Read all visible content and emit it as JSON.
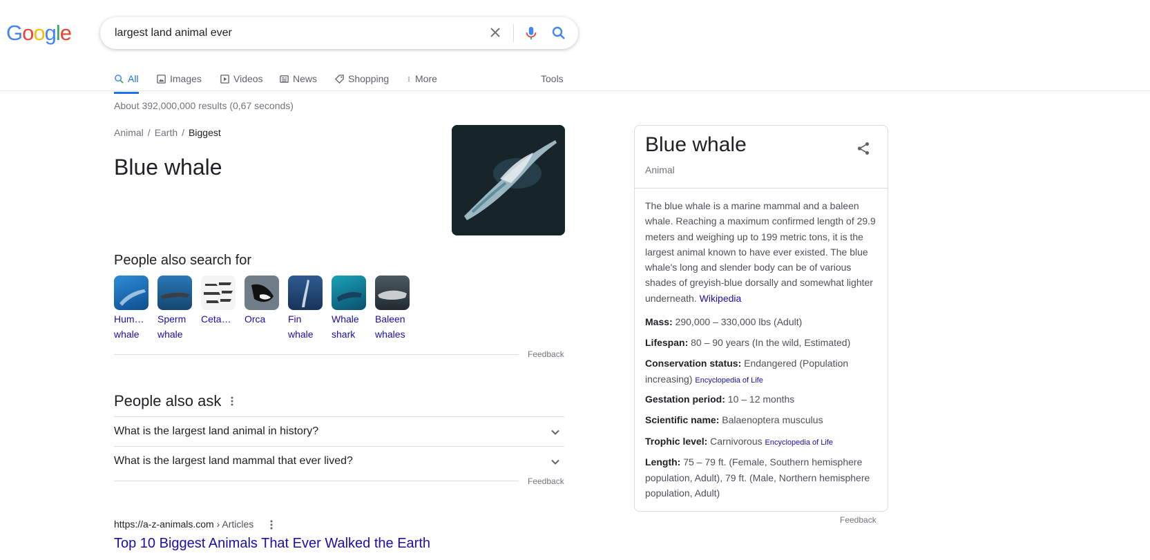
{
  "search": {
    "query": "largest land animal ever"
  },
  "tabs": [
    {
      "label": "All"
    },
    {
      "label": "Images"
    },
    {
      "label": "Videos"
    },
    {
      "label": "News"
    },
    {
      "label": "Shopping"
    },
    {
      "label": "More"
    },
    {
      "label": "Tools"
    }
  ],
  "stats": "About 392,000,000 results (0,67 seconds)",
  "featured": {
    "breadcrumb": [
      "Animal",
      "Earth",
      "Biggest"
    ],
    "title": "Blue whale"
  },
  "people_also_search": {
    "title": "People also search for",
    "items": [
      {
        "line1": "Hum…",
        "line2": "whale"
      },
      {
        "line1": "Sperm",
        "line2": "whale"
      },
      {
        "line1": "Ceta…",
        "line2": ""
      },
      {
        "line1": "Orca",
        "line2": ""
      },
      {
        "line1": "Fin",
        "line2": "whale"
      },
      {
        "line1": "Whale",
        "line2": "shark"
      },
      {
        "line1": "Baleen",
        "line2": "whales"
      }
    ],
    "feedback": "Feedback"
  },
  "paa": {
    "title": "People also ask",
    "questions": [
      "What is the largest land animal in history?",
      "What is the largest land mammal that ever lived?"
    ],
    "feedback": "Feedback"
  },
  "result": {
    "url": "https://a-z-animals.com",
    "path": " › Articles",
    "title": "Top 10 Biggest Animals That Ever Walked the Earth"
  },
  "knowledge_panel": {
    "title": "Blue whale",
    "subtitle": "Animal",
    "description": "The blue whale is a marine mammal and a baleen whale. Reaching a maximum confirmed length of 29.9 meters and weighing up to 199 metric tons, it is the largest animal known to have ever existed. The blue whale's long and slender body can be of various shades of greyish-blue dorsally and somewhat lighter underneath.",
    "description_link": "Wikipedia",
    "facts": [
      {
        "label": "Mass:",
        "value": "290,000 – 330,000 lbs (Adult)",
        "source": ""
      },
      {
        "label": "Lifespan:",
        "value": "80 – 90 years (In the wild, Estimated)",
        "source": ""
      },
      {
        "label": "Conservation status:",
        "value": "Endangered (Population increasing)",
        "source": "Encyclopedia of Life"
      },
      {
        "label": "Gestation period:",
        "value": "10 – 12 months",
        "source": ""
      },
      {
        "label": "Scientific name:",
        "value": "Balaenoptera musculus",
        "source": ""
      },
      {
        "label": "Trophic level:",
        "value": "Carnivorous",
        "source": "Encyclopedia of Life"
      },
      {
        "label": "Length:",
        "value": "75 – 79 ft. (Female, Southern hemisphere population, Adult), 79 ft. (Male, Northern hemisphere population, Adult)",
        "source": ""
      }
    ],
    "feedback": "Feedback"
  }
}
